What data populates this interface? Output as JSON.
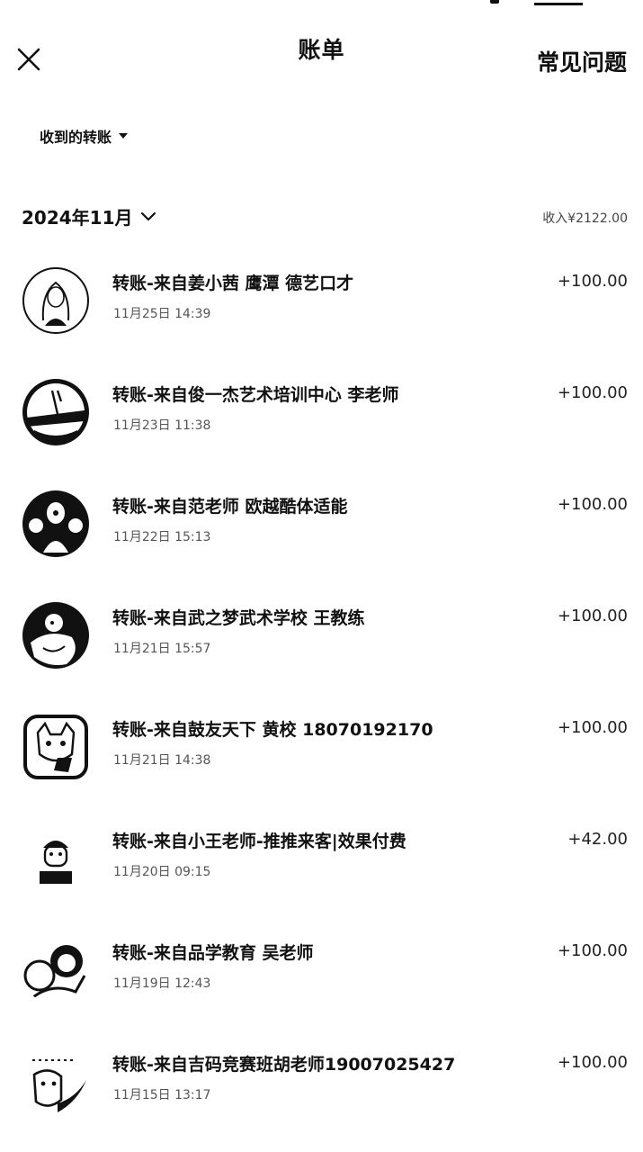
{
  "header": {
    "title": "账单",
    "faq_label": "常见问题"
  },
  "filter": {
    "label": "收到的转账"
  },
  "month": {
    "label": "2024年11月",
    "summary": "收入¥2122.00"
  },
  "transactions": [
    {
      "name": "转账-来自姜小茜 鹰潭 德艺口才",
      "time": "11月25日 14:39",
      "amount": "+100.00",
      "avatar": "girl-portrait-avatar"
    },
    {
      "name": "转账-来自俊一杰艺术培训中心 李老师",
      "time": "11月23日 11:38",
      "amount": "+100.00",
      "avatar": "dancer-avatar"
    },
    {
      "name": "转账-来自范老师 欧越酷体适能",
      "time": "11月22日 15:13",
      "amount": "+100.00",
      "avatar": "people-photo-avatar"
    },
    {
      "name": "转账-来自武之梦武术学校 王教练",
      "time": "11月21日 15:57",
      "amount": "+100.00",
      "avatar": "child-photo-avatar"
    },
    {
      "name": "转账-来自鼓友天下 黄校 18070192170",
      "time": "11月21日 14:38",
      "amount": "+100.00",
      "avatar": "cartoon-cat-avatar"
    },
    {
      "name": "转账-来自小王老师-推推来客|效果付费",
      "time": "11月20日 09:15",
      "amount": "+42.00",
      "avatar": "cartoon-boy-avatar"
    },
    {
      "name": "转账-来自品学教育 吴老师",
      "time": "11月19日 12:43",
      "amount": "+100.00",
      "avatar": "family-photo-avatar"
    },
    {
      "name": "转账-来自吉码竞赛班胡老师19007025427",
      "time": "11月15日 13:17",
      "amount": "+100.00",
      "avatar": "cartoon-pet-avatar"
    }
  ]
}
